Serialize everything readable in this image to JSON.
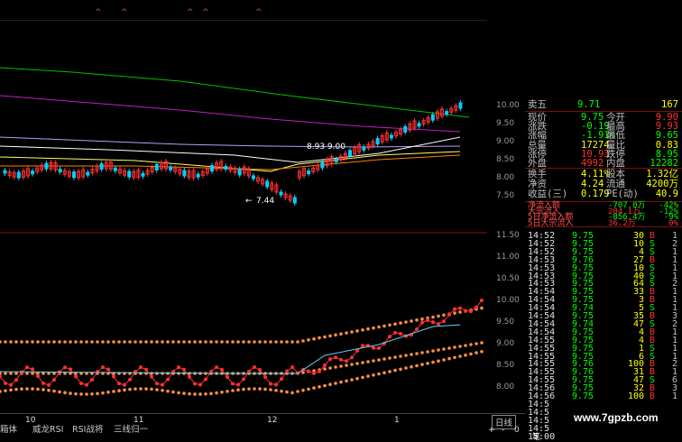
{
  "colors": {
    "up": "#ff3030",
    "down": "#00d0ff",
    "neutral": "#ffffff",
    "yellow": "#ffff00",
    "label": "#c0c0c0"
  },
  "top_markers": [
    "^",
    "^",
    "^",
    "^",
    "^"
  ],
  "chart_annotations": {
    "high_mark": "8.93 9.00",
    "low_mark": "7.44",
    "low_arrow": "←"
  },
  "price_axis": [
    "10.00",
    "9.50",
    "9.00",
    "8.50",
    "8.00",
    "7.50"
  ],
  "rsi_axis": [
    "11.50",
    "11.00",
    "10.50",
    "10.00",
    "9.50",
    "9.00",
    "8.50",
    "8.00"
  ],
  "date_labels": [
    "10",
    "11",
    "12",
    "1"
  ],
  "quote": {
    "sell5": {
      "label": "卖五",
      "price": "9.71",
      "vol": "167"
    },
    "rows": [
      {
        "l1": "现价",
        "v1": "9.75",
        "l2": "今开",
        "v2": "9.90"
      },
      {
        "l1": "涨跌",
        "v1": "-0.19",
        "l2": "最高",
        "v2": "9.93"
      },
      {
        "l1": "涨幅",
        "v1": "-1.91%",
        "l2": "最低",
        "v2": "9.65"
      },
      {
        "l1": "总量",
        "v1": "17274",
        "l2": "量比",
        "v2": "0.83"
      },
      {
        "l1": "涨停",
        "v1": "10.93",
        "l2": "跌停",
        "v2": "8.95"
      },
      {
        "l1": "外盘",
        "v1": "4992",
        "l2": "内盘",
        "v2": "12282"
      }
    ],
    "rows2": [
      {
        "l1": "换手",
        "v1": "4.11%",
        "l2": "股本",
        "v2": "1.32亿"
      },
      {
        "l1": "净资",
        "v1": "4.24",
        "l2": "流通",
        "v2": "4200万"
      },
      {
        "l1": "收益(三)",
        "v1": "0.179",
        "l2": "PE(动)",
        "v2": "40.9"
      }
    ],
    "flows": [
      {
        "label": "净流入额",
        "value": "-707.0万",
        "pct": "-42%"
      },
      {
        "label": "大宗流入",
        "value": "204.1万",
        "pct": "-12%"
      },
      {
        "label": "5日净流入额",
        "value": "-856.4万",
        "pct": "-9%"
      },
      {
        "label": "5日大宗流入",
        "value": "36.2万",
        "pct": "0%"
      }
    ]
  },
  "trades": [
    {
      "time": "14:52",
      "price": "9.75",
      "vol": "30",
      "side": "B",
      "n": "1"
    },
    {
      "time": "14:52",
      "price": "9.75",
      "vol": "10",
      "side": "S",
      "n": "2"
    },
    {
      "time": "14:52",
      "price": "9.75",
      "vol": "4",
      "side": "S",
      "n": "1"
    },
    {
      "time": "14:53",
      "price": "9.76",
      "vol": "27",
      "side": "B",
      "n": "1"
    },
    {
      "time": "14:53",
      "price": "9.75",
      "vol": "10",
      "side": "S",
      "n": "1"
    },
    {
      "time": "14:53",
      "price": "9.75",
      "vol": "40",
      "side": "S",
      "n": "1"
    },
    {
      "time": "14:53",
      "price": "9.75",
      "vol": "64",
      "side": "S",
      "n": "2"
    },
    {
      "time": "14:54",
      "price": "9.75",
      "vol": "33",
      "side": "B",
      "n": "1"
    },
    {
      "time": "14:54",
      "price": "9.75",
      "vol": "3",
      "side": "B",
      "n": "1"
    },
    {
      "time": "14:54",
      "price": "9.74",
      "vol": "5",
      "side": "S",
      "n": "1"
    },
    {
      "time": "14:54",
      "price": "9.75",
      "vol": "35",
      "side": "B",
      "n": "3"
    },
    {
      "time": "14:54",
      "price": "9.74",
      "vol": "47",
      "side": "S",
      "n": "2"
    },
    {
      "time": "14:54",
      "price": "9.75",
      "vol": "4",
      "side": "B",
      "n": "1"
    },
    {
      "time": "14:55",
      "price": "9.75",
      "vol": "4",
      "side": "B",
      "n": "1"
    },
    {
      "time": "14:55",
      "price": "9.75",
      "vol": "1",
      "side": "S",
      "n": "1"
    },
    {
      "time": "14:55",
      "price": "9.75",
      "vol": "6",
      "side": "S",
      "n": "1"
    },
    {
      "time": "14:55",
      "price": "9.76",
      "vol": "100",
      "side": "B",
      "n": "2"
    },
    {
      "time": "14:55",
      "price": "9.76",
      "vol": "31",
      "side": "B",
      "n": "1"
    },
    {
      "time": "14:55",
      "price": "9.75",
      "vol": "47",
      "side": "S",
      "n": "6"
    },
    {
      "time": "14:56",
      "price": "9.75",
      "vol": "32",
      "side": "B",
      "n": "3"
    },
    {
      "time": "14:56",
      "price": "9.75",
      "vol": "100",
      "side": "B",
      "n": "1"
    },
    {
      "time": "14:5",
      "price": "",
      "vol": "",
      "side": "",
      "n": ""
    },
    {
      "time": "14:5",
      "price": "",
      "vol": "",
      "side": "",
      "n": ""
    },
    {
      "time": "14:5",
      "price": "",
      "vol": "",
      "side": "",
      "n": ""
    },
    {
      "time": "14:5",
      "price": "",
      "vol": "",
      "side": "",
      "n": ""
    },
    {
      "time": "15:00",
      "price": "",
      "vol": "",
      "side": "",
      "n": ""
    }
  ],
  "bottom_tabs": [
    "箱体",
    "威龙RSI",
    "RSI战将",
    "三线归一"
  ],
  "minute_tab": "日线",
  "bottom_controls": {
    "plus": "+",
    "minus": "-",
    "zero": "0",
    "more": "笔"
  },
  "watermark": "www.7gpzb.com"
}
